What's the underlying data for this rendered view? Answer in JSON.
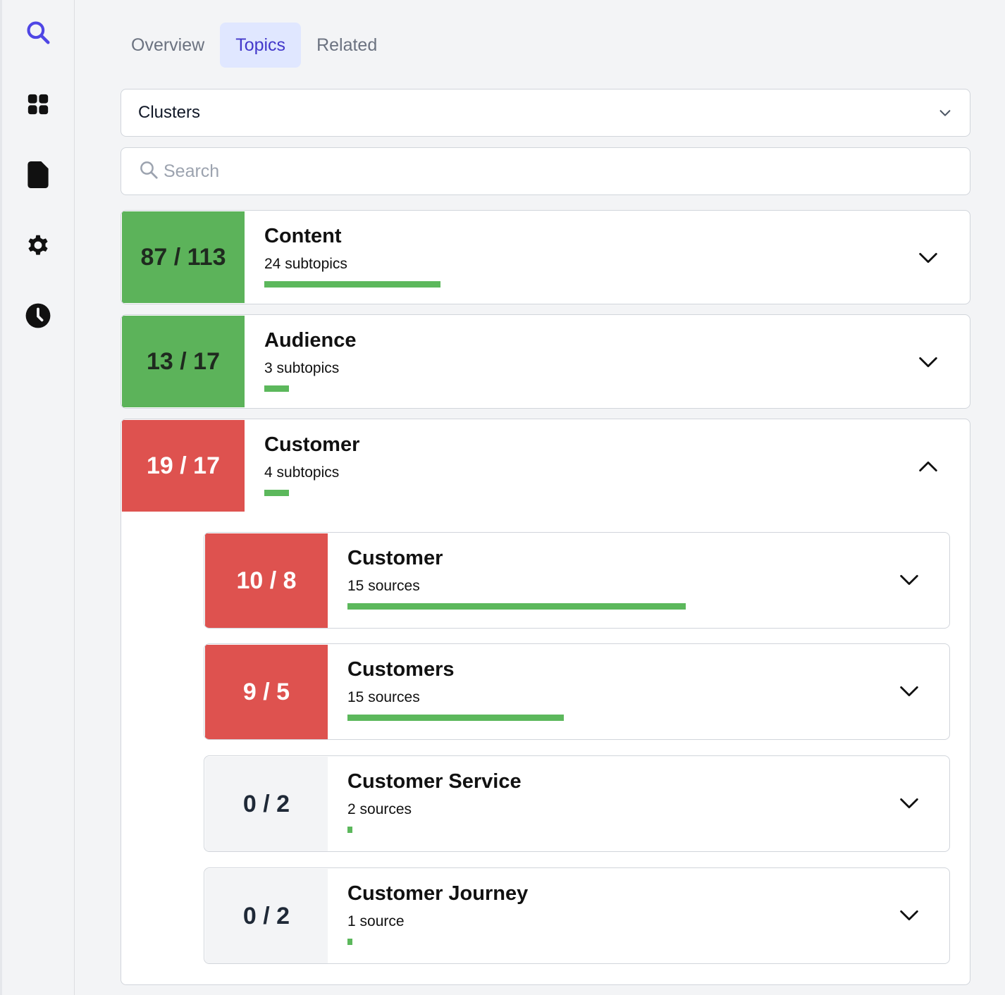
{
  "nav": {
    "icons": [
      "search-icon",
      "grid-icon",
      "document-icon",
      "gear-icon",
      "clock-icon"
    ],
    "active_color": "#4f46e5"
  },
  "tabs": [
    {
      "label": "Overview",
      "active": false
    },
    {
      "label": "Topics",
      "active": true
    },
    {
      "label": "Related",
      "active": false
    }
  ],
  "filter": {
    "selected": "Clusters"
  },
  "search": {
    "placeholder": "Search",
    "value": ""
  },
  "colors": {
    "green": "#5cb35a",
    "red": "#de524f",
    "gray": "#f3f4f6",
    "bar": "#5cb85c",
    "tab_active_bg": "#e0e7ff",
    "tab_active_text": "#4338ca"
  },
  "clusters": [
    {
      "score": "87 / 113",
      "title": "Content",
      "subtitle": "24 subtopics",
      "status": "green",
      "expanded": false,
      "bar_fraction": 0.26
    },
    {
      "score": "13 / 17",
      "title": "Audience",
      "subtitle": "3 subtopics",
      "status": "green",
      "expanded": false,
      "bar_fraction": 0.036
    },
    {
      "score": "19 / 17",
      "title": "Customer",
      "subtitle": "4 subtopics",
      "status": "red",
      "expanded": true,
      "bar_fraction": 0.036,
      "children": [
        {
          "score": "10 / 8",
          "title": "Customer",
          "subtitle": "15 sources",
          "status": "red",
          "bar_fraction": 0.5
        },
        {
          "score": "9 / 5",
          "title": "Customers",
          "subtitle": "15 sources",
          "status": "red",
          "bar_fraction": 0.32
        },
        {
          "score": "0 / 2",
          "title": "Customer Service",
          "subtitle": "2 sources",
          "status": "gray",
          "bar_fraction": 0.007
        },
        {
          "score": "0 / 2",
          "title": "Customer Journey",
          "subtitle": "1 source",
          "status": "gray",
          "bar_fraction": 0.007
        }
      ]
    }
  ]
}
